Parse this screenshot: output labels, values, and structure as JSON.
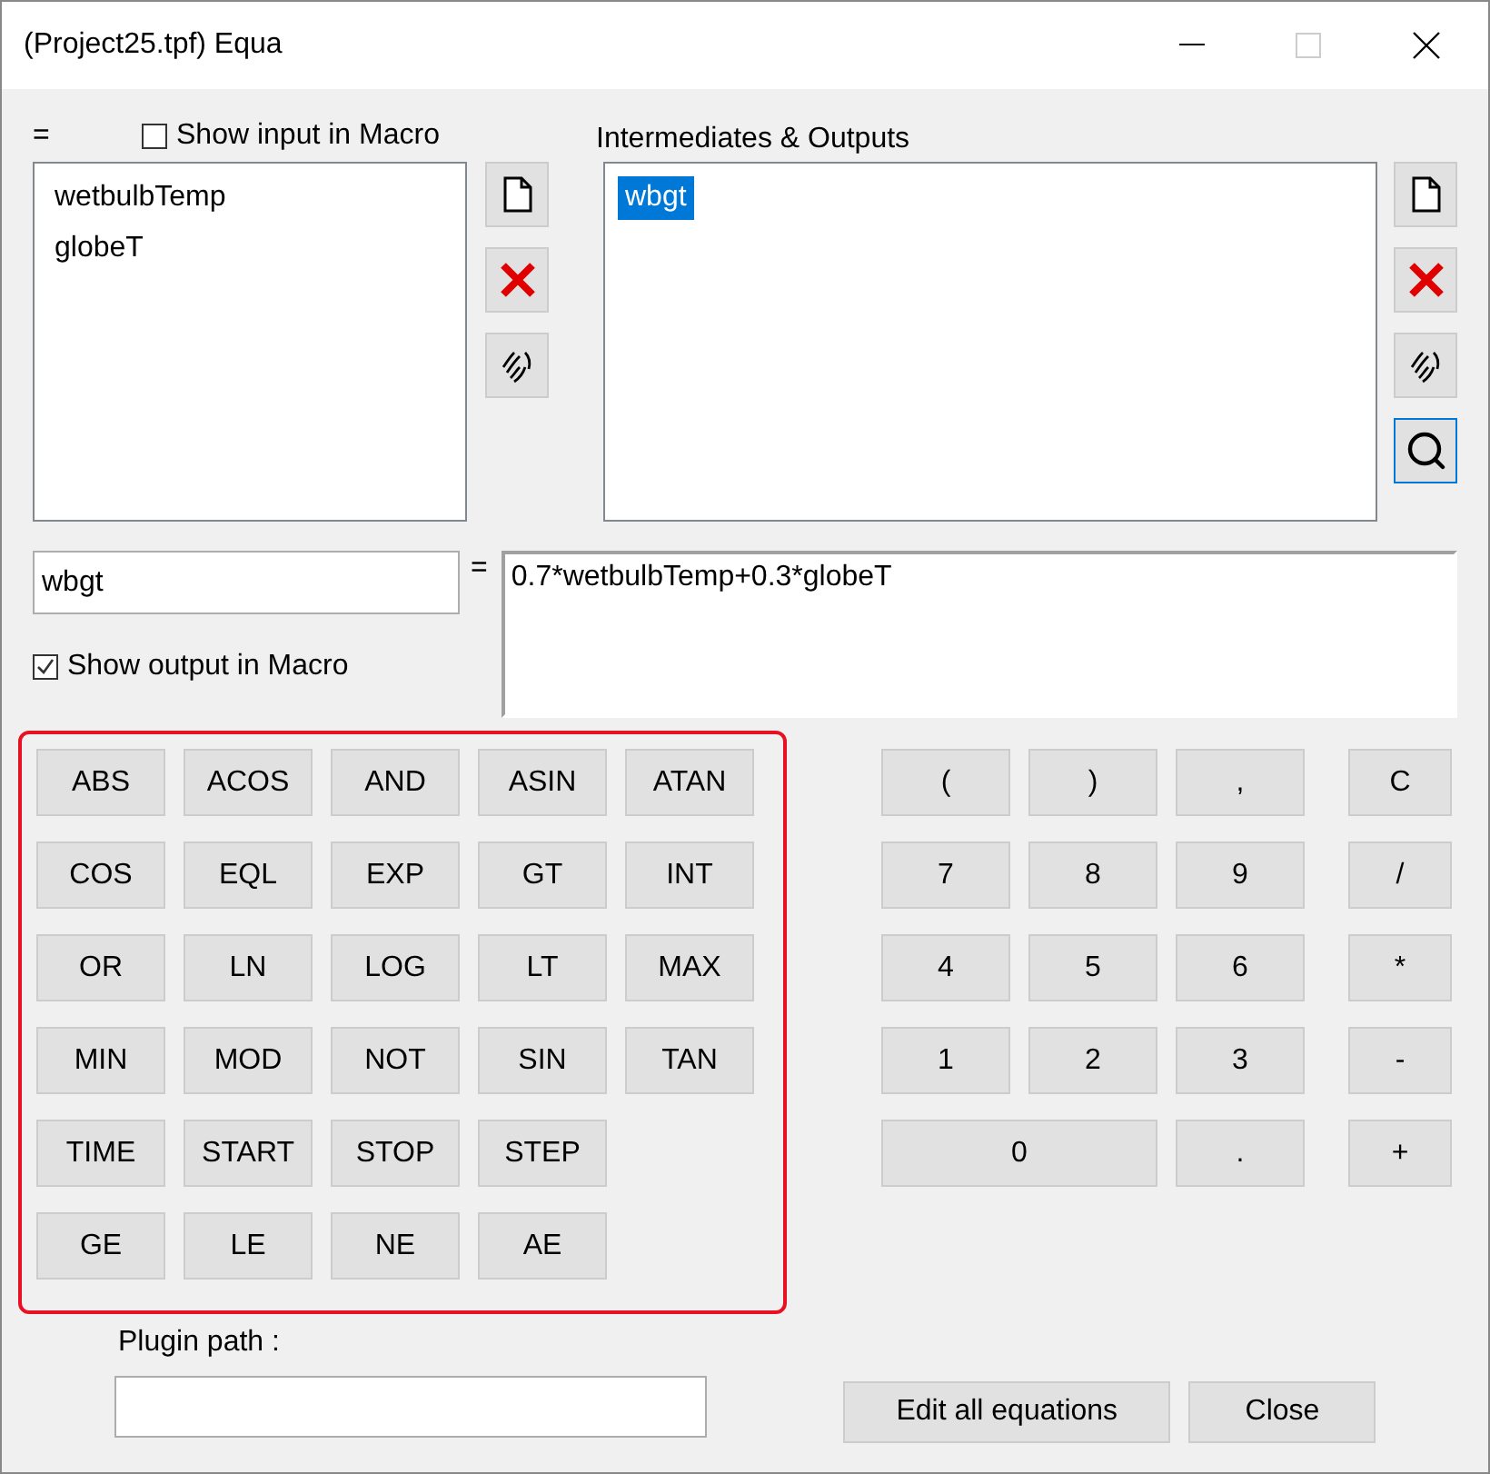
{
  "window": {
    "title": "(Project25.tpf) Equa"
  },
  "inputs": {
    "label": "=",
    "show_in_macro": {
      "label": "Show input in Macro",
      "checked": false
    },
    "items": [
      {
        "label": "wetbulbTemp",
        "selected": false
      },
      {
        "label": "globeT",
        "selected": false
      }
    ],
    "tools": [
      {
        "kind": "new",
        "focused": false
      },
      {
        "kind": "delete",
        "focused": false
      },
      {
        "kind": "edit",
        "focused": false
      }
    ]
  },
  "outputs": {
    "label": "Intermediates & Outputs",
    "items": [
      {
        "label": "wbgt",
        "selected": true
      }
    ],
    "tools": [
      {
        "kind": "new",
        "focused": false
      },
      {
        "kind": "delete",
        "focused": false
      },
      {
        "kind": "edit",
        "focused": false
      },
      {
        "kind": "find",
        "focused": true
      }
    ]
  },
  "equation": {
    "name": "wbgt",
    "equals": "=",
    "expression": "0.7*wetbulbTemp+0.3*globeT",
    "show_in_macro": {
      "label": "Show output in Macro",
      "checked": true
    }
  },
  "function_rows": [
    [
      "ABS",
      "ACOS",
      "AND",
      "ASIN",
      "ATAN"
    ],
    [
      "COS",
      "EQL",
      "EXP",
      "GT",
      "INT"
    ],
    [
      "OR",
      "LN",
      "LOG",
      "LT",
      "MAX"
    ],
    [
      "MIN",
      "MOD",
      "NOT",
      "SIN",
      "TAN"
    ],
    [
      "TIME",
      "START",
      "STOP",
      "STEP"
    ],
    [
      "GE",
      "LE",
      "NE",
      "AE"
    ]
  ],
  "keypad": [
    {
      "label": "(",
      "kind": "key"
    },
    {
      "label": ")",
      "kind": "key"
    },
    {
      "label": ",",
      "kind": "key"
    },
    {
      "label": "C",
      "kind": "op"
    },
    {
      "label": "7",
      "kind": "key"
    },
    {
      "label": "8",
      "kind": "key"
    },
    {
      "label": "9",
      "kind": "key"
    },
    {
      "label": "/",
      "kind": "op"
    },
    {
      "label": "4",
      "kind": "key"
    },
    {
      "label": "5",
      "kind": "key"
    },
    {
      "label": "6",
      "kind": "key"
    },
    {
      "label": "*",
      "kind": "op"
    },
    {
      "label": "1",
      "kind": "key"
    },
    {
      "label": "2",
      "kind": "key"
    },
    {
      "label": "3",
      "kind": "key"
    },
    {
      "label": "-",
      "kind": "op"
    },
    {
      "label": "0",
      "kind": "wide"
    },
    {
      "label": ".",
      "kind": "key"
    },
    {
      "label": "+",
      "kind": "op"
    }
  ],
  "plugin": {
    "label": "Plugin path :"
  },
  "buttons": [
    "Edit all equations",
    "Close"
  ]
}
